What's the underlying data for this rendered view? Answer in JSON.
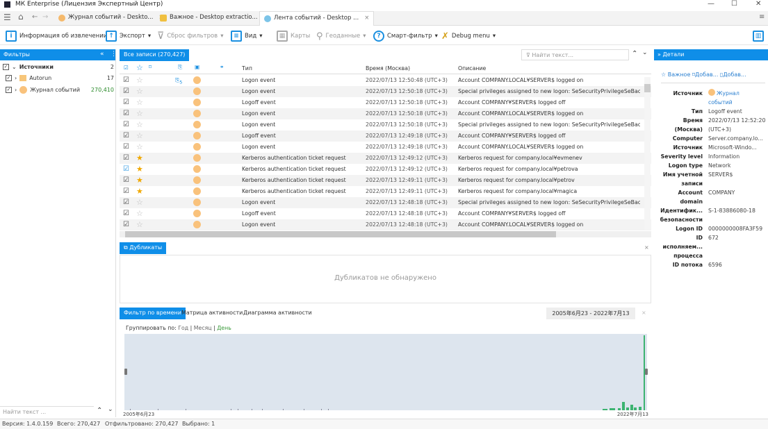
{
  "window": {
    "title": "МК Enterprise (Лицензия Экспертный Центр)"
  },
  "tabs": [
    {
      "label": "Журнал событий - Deskto...",
      "active": false
    },
    {
      "label": "Важное - Desktop extractio...",
      "active": false
    },
    {
      "label": "Лента событий - Desktop ...",
      "active": true
    }
  ],
  "toolbar": {
    "info": "Информация об извлечении",
    "export": "Экспорт",
    "reset_filters": "Сброс фильтров",
    "view": "Вид",
    "maps": "Карты",
    "geodata": "Геоданные",
    "smart_filter": "Смарт-фильтр",
    "debug": "Debug menu"
  },
  "filters": {
    "title": "Фильтры",
    "items": [
      {
        "label": "Источники",
        "count": "2",
        "checked": true
      },
      {
        "label": "Autorun",
        "count": "17",
        "checked": true
      },
      {
        "label": "Журнал событий",
        "count": "270,410",
        "checked": true
      }
    ],
    "search_placeholder": "Найти текст ..."
  },
  "grid": {
    "tab": "Все записи (270,427)",
    "search_placeholder": "Найти текст...",
    "columns": {
      "type": "Тип",
      "time": "Время (Москва)",
      "desc": "Описание"
    },
    "rows": [
      {
        "star": false,
        "type": "Logon event",
        "time": "2022/07/13 12:50:48 (UTC+3)",
        "desc": "Account COMPANY.LOCAL¥SERVER$ logged on",
        "attach": "5"
      },
      {
        "star": false,
        "type": "Logon event",
        "time": "2022/07/13 12:50:18 (UTC+3)",
        "desc": "Special privileges assigned to new logon: SeSecurityPrivilegeSeBackupPri"
      },
      {
        "star": false,
        "type": "Logoff event",
        "time": "2022/07/13 12:50:18 (UTC+3)",
        "desc": "Account COMPANY¥SERVER$ logged off"
      },
      {
        "star": false,
        "type": "Logon event",
        "time": "2022/07/13 12:50:18 (UTC+3)",
        "desc": "Account COMPANY.LOCAL¥SERVER$ logged on"
      },
      {
        "star": false,
        "type": "Logon event",
        "time": "2022/07/13 12:50:18 (UTC+3)",
        "desc": "Special privileges assigned to new logon: SeSecurityPrivilegeSeBackupPri"
      },
      {
        "star": false,
        "type": "Logoff event",
        "time": "2022/07/13 12:49:18 (UTC+3)",
        "desc": "Account COMPANY¥SERVER$ logged off"
      },
      {
        "star": false,
        "type": "Logon event",
        "time": "2022/07/13 12:49:18 (UTC+3)",
        "desc": "Account COMPANY.LOCAL¥SERVER$ logged on"
      },
      {
        "star": true,
        "type": "Kerberos authentication ticket request",
        "time": "2022/07/13 12:49:12 (UTC+3)",
        "desc": "Kerberos request for company.local¥evmenev"
      },
      {
        "star": true,
        "type": "Kerberos authentication ticket request",
        "time": "2022/07/13 12:49:12 (UTC+3)",
        "desc": "Kerberos request for company.local¥petrova"
      },
      {
        "star": true,
        "type": "Kerberos authentication ticket request",
        "time": "2022/07/13 12:49:11 (UTC+3)",
        "desc": "Kerberos request for company.local¥petrov"
      },
      {
        "star": true,
        "type": "Kerberos authentication ticket request",
        "time": "2022/07/13 12:49:11 (UTC+3)",
        "desc": "Kerberos request for company.local¥magica"
      },
      {
        "star": false,
        "type": "Logon event",
        "time": "2022/07/13 12:48:18 (UTC+3)",
        "desc": "Special privileges assigned to new logon: SeSecurityPrivilegeSeBackupPri"
      },
      {
        "star": false,
        "type": "Logoff event",
        "time": "2022/07/13 12:48:18 (UTC+3)",
        "desc": "Account COMPANY¥SERVER$ logged off"
      },
      {
        "star": false,
        "type": "Logon event",
        "time": "2022/07/13 12:48:18 (UTC+3)",
        "desc": "Account COMPANY.LOCAL¥SERVER$ logged on"
      }
    ]
  },
  "duplicates": {
    "tab": "Дубликаты",
    "empty": "Дубликатов не обнаружено"
  },
  "timeline": {
    "tabs": [
      "Фильтр по времени",
      "Матрица активности",
      "Диаграмма активности"
    ],
    "range": "2005年6月23 - 2022年7月13",
    "group_by": "Группировать по:",
    "group_year": "Год",
    "group_month": "Месяц",
    "group_day": "День",
    "start": "2005年6月23",
    "end": "2022年7月13",
    "accent": "#3cb371"
  },
  "details": {
    "title": "Детали",
    "actions": [
      "Важное",
      "Добав...",
      "Добав..."
    ],
    "fields": [
      {
        "k": "Источник",
        "v": "Журнал"
      },
      {
        "k": "",
        "v": "событий"
      },
      {
        "k": "Тип",
        "v": "Logoff event"
      },
      {
        "k": "Время",
        "v": "2022/07/13 12:52:20"
      },
      {
        "k": "(Москва)",
        "v": "(UTC+3)"
      },
      {
        "k": "Computer",
        "v": "Server.company.lo..."
      },
      {
        "k": "Источник",
        "v": "Microsoft-Windo..."
      },
      {
        "k": "Severity level",
        "v": "Information"
      },
      {
        "k": "Logon type",
        "v": "Network"
      },
      {
        "k": "Имя учетной",
        "v": "SERVER$"
      },
      {
        "k": "записи",
        "v": ""
      },
      {
        "k": "Account",
        "v": "COMPANY"
      },
      {
        "k": "domain",
        "v": ""
      },
      {
        "k": "Идентифик...",
        "v": "S-1-83886080-18"
      },
      {
        "k": "безопасности",
        "v": ""
      },
      {
        "k": "Logon ID",
        "v": "0000000008FA3F59"
      },
      {
        "k": "ID",
        "v": "672"
      },
      {
        "k": "исполняем...",
        "v": ""
      },
      {
        "k": "процесса",
        "v": ""
      },
      {
        "k": "ID потока",
        "v": "6596"
      }
    ]
  },
  "status": {
    "version": "Версия: 1.4.0.159",
    "total": "Всего: 270,427",
    "filtered": "Отфильтровано: 270,427",
    "selected": "Выбрано: 1"
  },
  "colors": {
    "accent": "#0f8ee8",
    "star": "#f0a800"
  }
}
